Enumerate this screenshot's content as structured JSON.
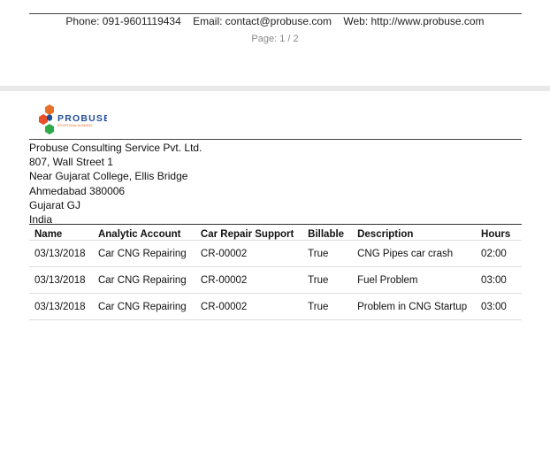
{
  "footer": {
    "phone": "Phone: 091-9601119434",
    "email": "Email: contact@probuse.com",
    "web": "Web: http://www.probuse.com",
    "page": "Page: 1 / 2"
  },
  "company": {
    "logo_text": "PROBUSE",
    "logo_tagline": "EXCEPTIONAL BUSINESS",
    "brand_colors": [
      "#e8702a",
      "#e94e2b",
      "#2eaa4b",
      "#1f4e9a"
    ],
    "address": [
      "Probuse Consulting Service Pvt. Ltd.",
      "807, Wall Street 1",
      "Near Gujarat College, Ellis Bridge",
      "Ahmedabad 380006",
      "Gujarat GJ",
      "India"
    ]
  },
  "table": {
    "headers": [
      "Name",
      "Analytic Account",
      "Car Repair Support",
      "Billable",
      "Description",
      "Hours"
    ],
    "rows": [
      [
        "03/13/2018",
        "Car CNG Repairing",
        "CR-00002",
        "True",
        "CNG Pipes car crash",
        "02:00"
      ],
      [
        "03/13/2018",
        "Car CNG Repairing",
        "CR-00002",
        "True",
        "Fuel Problem",
        "03:00"
      ],
      [
        "03/13/2018",
        "Car CNG Repairing",
        "CR-00002",
        "True",
        "Problem in CNG Startup",
        "03:00"
      ]
    ]
  }
}
